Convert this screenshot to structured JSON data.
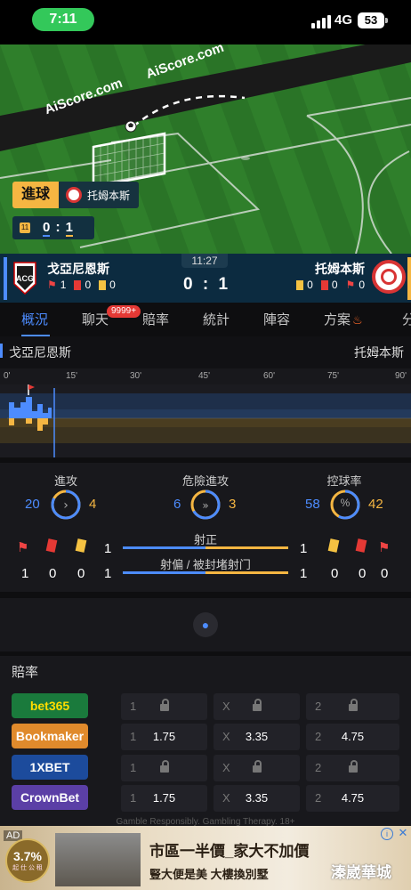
{
  "status_bar": {
    "time": "7:11",
    "network": "4G",
    "battery": "53"
  },
  "pitch": {
    "ad_boards": [
      "AiScore.com",
      "AiScore.com"
    ],
    "event_label": "進球",
    "event_team": "托姆本斯",
    "mini_score_minute": "11",
    "mini_score_home": "0",
    "mini_score_sep": ":",
    "mini_score_away": "1"
  },
  "match": {
    "home_team": "戈亞尼恩斯",
    "away_team": "托姆本斯",
    "clock": "11:27",
    "score_home": "0",
    "score_sep": ":",
    "score_away": "1",
    "home_counts": {
      "corners": "1",
      "red": "0",
      "yellow": "0"
    },
    "away_counts": {
      "yellow": "0",
      "red": "0",
      "corners": "0"
    }
  },
  "tabs": [
    {
      "label": "概況",
      "active": true
    },
    {
      "label": "聊天"
    },
    {
      "label": "賠率"
    },
    {
      "label": "統計"
    },
    {
      "label": "陣容"
    },
    {
      "label": "方案"
    },
    {
      "label": "分"
    }
  ],
  "chat_badge": "9999+",
  "timeline": {
    "home_team": "戈亞尼恩斯",
    "away_team": "托姆本斯",
    "ticks": [
      "0'",
      "15'",
      "30'",
      "45'",
      "60'",
      "75'",
      "90'"
    ]
  },
  "stats": {
    "attack": {
      "label": "進攻",
      "home": "20",
      "away": "4",
      "home_share": 0.83
    },
    "dangerous_attack": {
      "label": "危險進攻",
      "home": "6",
      "away": "3",
      "home_share": 0.67
    },
    "possession": {
      "label": "控球率",
      "home": "58",
      "away": "42",
      "home_share": 0.58,
      "icon": "%"
    },
    "home_cards": {
      "corners": "1",
      "red": "0",
      "yellow": "0"
    },
    "away_cards": {
      "yellow": "0",
      "red": "0",
      "corners": "0"
    },
    "shots_on": {
      "label": "射正",
      "home": "1",
      "away": "1",
      "home_share": 0.5
    },
    "shots_off": {
      "label": "射偏 / 被封堵射门",
      "home": "1",
      "away": "1",
      "home_share": 0.5
    }
  },
  "odds": {
    "title": "賠率",
    "rows": [
      {
        "bookmaker": "bet365",
        "bg": "#1a7a3c",
        "fg": "#ffdd00",
        "c1": "1",
        "v1": "",
        "cx": "X",
        "vx": "",
        "c2": "2",
        "v2": "",
        "locked": true
      },
      {
        "bookmaker": "Bookmaker",
        "bg": "#e08a2c",
        "fg": "#ffffff",
        "c1": "1",
        "v1": "1.75",
        "cx": "X",
        "vx": "3.35",
        "c2": "2",
        "v2": "4.75",
        "locked": false
      },
      {
        "bookmaker": "1XBET",
        "bg": "#1c4b9c",
        "fg": "#ffffff",
        "c1": "1",
        "v1": "",
        "cx": "X",
        "vx": "",
        "c2": "2",
        "v2": "",
        "locked": true
      },
      {
        "bookmaker": "CrownBet",
        "bg": "#5b3fa6",
        "fg": "#ffffff",
        "c1": "1",
        "v1": "1.75",
        "cx": "X",
        "vx": "3.35",
        "c2": "2",
        "v2": "4.75",
        "locked": false
      }
    ],
    "footer": "Gamble Responsibly. Gambling Therapy. 18+"
  },
  "ad": {
    "tag": "AD",
    "rate": "3.7%",
    "rate_sub": "起 仕 公 租",
    "headline": "市區一半價_家大不加價",
    "subline": "豎大便是美 大樓換別墅",
    "brand": "溱崴華城"
  },
  "colors": {
    "home": "#4d8cff",
    "away": "#f5b642",
    "accent": "#4d8cff"
  }
}
